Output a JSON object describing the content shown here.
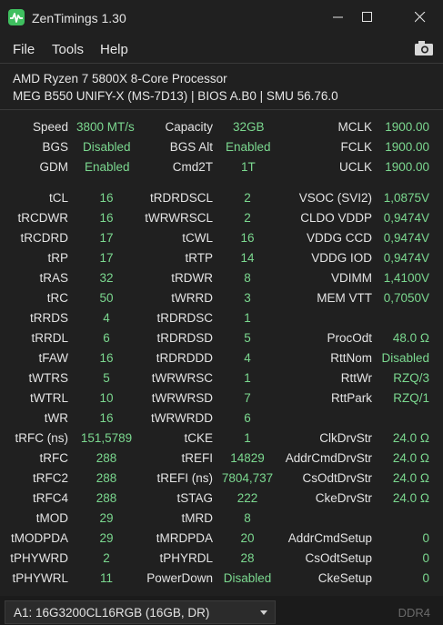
{
  "window": {
    "title": "ZenTimings 1.30"
  },
  "menu": {
    "file": "File",
    "tools": "Tools",
    "help": "Help"
  },
  "cpu": {
    "name": "AMD Ryzen 7 5800X 8-Core Processor",
    "board": "MEG B550 UNIFY-X (MS-7D13) | BIOS A.B0 | SMU 56.76.0"
  },
  "top": {
    "speed": {
      "label": "Speed",
      "value": "3800 MT/s"
    },
    "capacity": {
      "label": "Capacity",
      "value": "32GB"
    },
    "mclk": {
      "label": "MCLK",
      "value": "1900.00"
    },
    "bgs": {
      "label": "BGS",
      "value": "Disabled"
    },
    "bgsalt": {
      "label": "BGS Alt",
      "value": "Enabled"
    },
    "fclk": {
      "label": "FCLK",
      "value": "1900.00"
    },
    "gdm": {
      "label": "GDM",
      "value": "Enabled"
    },
    "cmd2t": {
      "label": "Cmd2T",
      "value": "1T"
    },
    "uclk": {
      "label": "UCLK",
      "value": "1900.00"
    }
  },
  "col1": [
    {
      "label": "tCL",
      "value": "16"
    },
    {
      "label": "tRCDWR",
      "value": "16"
    },
    {
      "label": "tRCDRD",
      "value": "17"
    },
    {
      "label": "tRP",
      "value": "17"
    },
    {
      "label": "tRAS",
      "value": "32"
    },
    {
      "label": "tRC",
      "value": "50"
    },
    {
      "label": "tRRDS",
      "value": "4"
    },
    {
      "label": "tRRDL",
      "value": "6"
    },
    {
      "label": "tFAW",
      "value": "16"
    },
    {
      "label": "tWTRS",
      "value": "5"
    },
    {
      "label": "tWTRL",
      "value": "10"
    },
    {
      "label": "tWR",
      "value": "16"
    },
    {
      "label": "tRFC (ns)",
      "value": "151,5789"
    },
    {
      "label": "tRFC",
      "value": "288"
    },
    {
      "label": "tRFC2",
      "value": "288"
    },
    {
      "label": "tRFC4",
      "value": "288"
    },
    {
      "label": "tMOD",
      "value": "29"
    },
    {
      "label": "tMODPDA",
      "value": "29"
    },
    {
      "label": "tPHYWRD",
      "value": "2"
    },
    {
      "label": "tPHYWRL",
      "value": "11"
    }
  ],
  "col2": [
    {
      "label": "tRDRDSCL",
      "value": "2"
    },
    {
      "label": "tWRWRSCL",
      "value": "2"
    },
    {
      "label": "tCWL",
      "value": "16"
    },
    {
      "label": "tRTP",
      "value": "14"
    },
    {
      "label": "tRDWR",
      "value": "8"
    },
    {
      "label": "tWRRD",
      "value": "3"
    },
    {
      "label": "tRDRDSC",
      "value": "1"
    },
    {
      "label": "tRDRDSD",
      "value": "5"
    },
    {
      "label": "tRDRDDD",
      "value": "4"
    },
    {
      "label": "tWRWRSC",
      "value": "1"
    },
    {
      "label": "tWRWRSD",
      "value": "7"
    },
    {
      "label": "tWRWRDD",
      "value": "6"
    },
    {
      "label": "tCKE",
      "value": "1"
    },
    {
      "label": "tREFI",
      "value": "14829"
    },
    {
      "label": "tREFI (ns)",
      "value": "7804,737"
    },
    {
      "label": "tSTAG",
      "value": "222"
    },
    {
      "label": "tMRD",
      "value": "8"
    },
    {
      "label": "tMRDPDA",
      "value": "20"
    },
    {
      "label": "tPHYRDL",
      "value": "28"
    },
    {
      "label": "PowerDown",
      "value": "Disabled"
    }
  ],
  "col3": [
    {
      "label": "VSOC (SVI2)",
      "value": "1,0875V"
    },
    {
      "label": "CLDO VDDP",
      "value": "0,9474V"
    },
    {
      "label": "VDDG CCD",
      "value": "0,9474V"
    },
    {
      "label": "VDDG IOD",
      "value": "0,9474V"
    },
    {
      "label": "VDIMM",
      "value": "1,4100V"
    },
    {
      "label": "MEM VTT",
      "value": "0,7050V"
    },
    {
      "label": "",
      "value": ""
    },
    {
      "label": "ProcOdt",
      "value": "48.0 Ω"
    },
    {
      "label": "RttNom",
      "value": "Disabled"
    },
    {
      "label": "RttWr",
      "value": "RZQ/3"
    },
    {
      "label": "RttPark",
      "value": "RZQ/1"
    },
    {
      "label": "",
      "value": ""
    },
    {
      "label": "ClkDrvStr",
      "value": "24.0 Ω"
    },
    {
      "label": "AddrCmdDrvStr",
      "value": "24.0 Ω"
    },
    {
      "label": "CsOdtDrvStr",
      "value": "24.0 Ω"
    },
    {
      "label": "CkeDrvStr",
      "value": "24.0 Ω"
    },
    {
      "label": "",
      "value": ""
    },
    {
      "label": "AddrCmdSetup",
      "value": "0"
    },
    {
      "label": "CsOdtSetup",
      "value": "0"
    },
    {
      "label": "CkeSetup",
      "value": "0"
    }
  ],
  "footer": {
    "dimm": "A1: 16G3200CL16RGB (16GB, DR)",
    "memtype": "DDR4"
  },
  "colors": {
    "value": "#7bd88f",
    "background": "#202020",
    "icon": "#3fbf5f"
  }
}
